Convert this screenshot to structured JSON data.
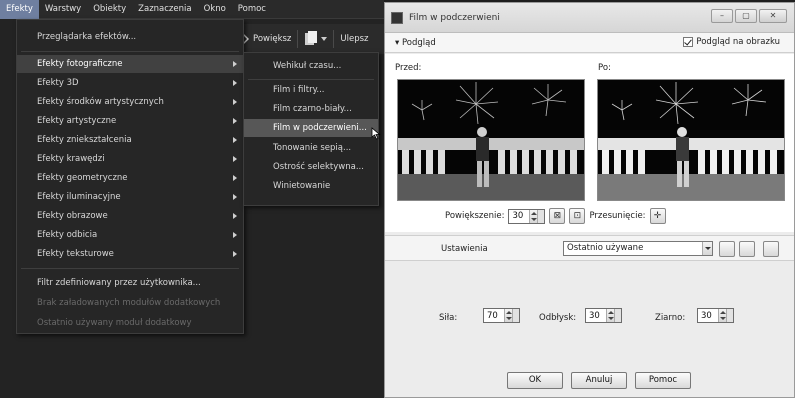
{
  "menubar": {
    "items": [
      "Efekty",
      "Warstwy",
      "Obiekty",
      "Zaznaczenia",
      "Okno",
      "Pomoc"
    ]
  },
  "toolbar": {
    "zoom_label": "Powiększ",
    "enhance_label": "Ulepsz"
  },
  "effects_menu": {
    "browser": "Przeglądarka efektów...",
    "items": [
      "Efekty fotograficzne",
      "Efekty 3D",
      "Efekty środków artystycznych",
      "Efekty artystyczne",
      "Efekty zniekształcenia",
      "Efekty krawędzi",
      "Efekty geometryczne",
      "Efekty iluminacyjne",
      "Efekty obrazowe",
      "Efekty odbicia",
      "Efekty teksturowe"
    ],
    "user_filter": "Filtr zdefiniowany przez użytkownika...",
    "no_plugins": "Brak załadowanych modułów dodatkowych",
    "last_plugin": "Ostatnio używany moduł dodatkowy"
  },
  "photo_submenu": {
    "items": [
      "Wehikuł czasu...",
      "Film i filtry...",
      "Film czarno-biały...",
      "Film w podczerwieni...",
      "Tonowanie sepią...",
      "Ostrość selektywna...",
      "Winietowanie"
    ]
  },
  "dialog": {
    "title": "Film w podczerwieni",
    "preview_toggle": "Podgląd",
    "preview_on_image": "Podgląd na obrazku",
    "before_label": "Przed:",
    "after_label": "Po:",
    "zoom_label": "Powiększenie:",
    "zoom_value": "30",
    "pan_label": "Przesunięcie:",
    "settings_label": "Ustawienia",
    "preset_value": "Ostatnio używane",
    "strength_label": "Siła:",
    "strength_value": "70",
    "glare_label": "Odbłysk:",
    "glare_value": "30",
    "grain_label": "Ziarno:",
    "grain_value": "30",
    "ok_label": "OK",
    "cancel_label": "Anuluj",
    "help_label": "Pomoc"
  }
}
